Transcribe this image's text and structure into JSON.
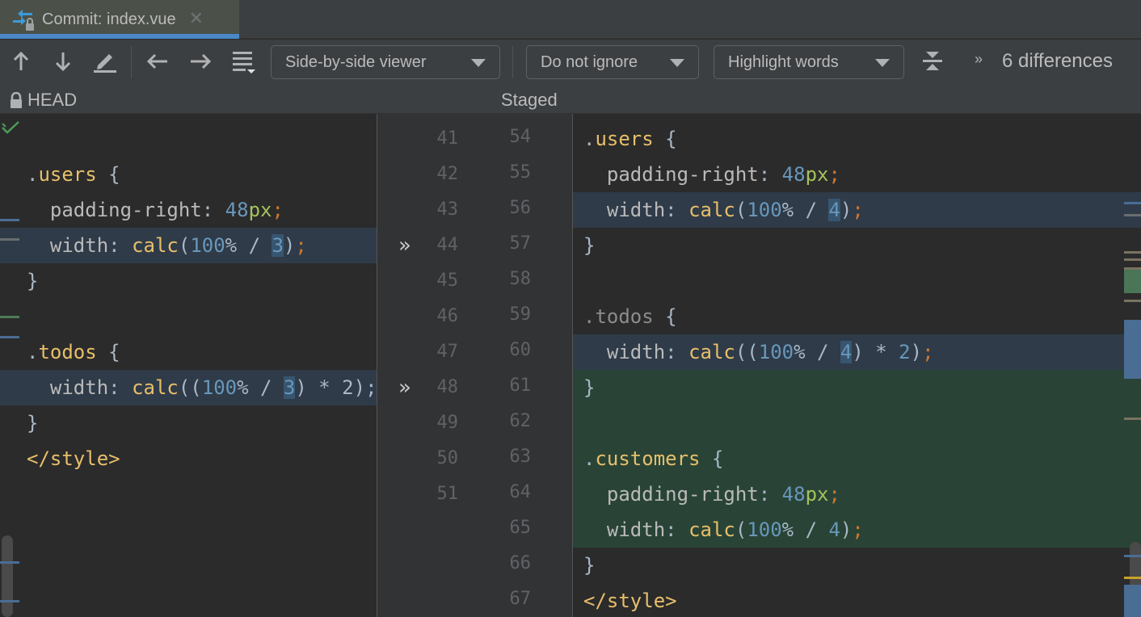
{
  "tab": {
    "title": "Commit: index.vue",
    "icon": "diff-commit-icon",
    "close_icon": "close-icon"
  },
  "toolbar": {
    "prev_diff_icon": "arrow-up-icon",
    "next_diff_icon": "arrow-down-icon",
    "edit_icon": "pencil-icon",
    "prev_file_icon": "arrow-left-icon",
    "next_file_icon": "arrow-right-icon",
    "jump_list_icon": "list-dropdown-icon",
    "viewer_mode": "Side-by-side viewer",
    "whitespace_mode": "Do not ignore",
    "highlight_mode": "Highlight words",
    "collapse_icon": "collapse-unchanged-icon",
    "more_icon": "double-chevron-right-icon",
    "more_glyph": "»",
    "differences": "6 differences"
  },
  "headers": {
    "left": "HEAD",
    "left_icon": "lock-icon",
    "right": "Staged"
  },
  "colors": {
    "accent": "#4a88c7",
    "modified_bg": "#2f3b48",
    "added_bg": "#294436",
    "word_highlight": "#385570",
    "connector": "#355572"
  },
  "left_pane": {
    "lines": [
      {
        "segments": []
      },
      {
        "segments": [
          {
            "t": ".",
            "c": "c-dot"
          },
          {
            "t": "users",
            "c": "c-sel"
          },
          {
            "t": " {",
            "c": "c-punc"
          }
        ]
      },
      {
        "segments": [
          {
            "t": "  padding-right",
            "c": "c-prop"
          },
          {
            "t": ": ",
            "c": "c-punc"
          },
          {
            "t": "48",
            "c": "c-num"
          },
          {
            "t": "px",
            "c": "c-unit"
          },
          {
            "t": ";",
            "c": "c-semi"
          }
        ]
      },
      {
        "hl": "hl-mod",
        "segments": [
          {
            "t": "  width",
            "c": "c-prop"
          },
          {
            "t": ": ",
            "c": "c-punc"
          },
          {
            "t": "calc",
            "c": "c-fn"
          },
          {
            "t": "(",
            "c": "c-punc"
          },
          {
            "t": "100",
            "c": "c-num"
          },
          {
            "t": "% / ",
            "c": "c-punc"
          },
          {
            "t": "3",
            "c": "c-num w-mod"
          },
          {
            "t": ")",
            "c": "c-punc"
          },
          {
            "t": ";",
            "c": "c-semi"
          }
        ]
      },
      {
        "segments": [
          {
            "t": "}",
            "c": "c-punc"
          }
        ]
      },
      {
        "segments": []
      },
      {
        "segments": [
          {
            "t": ".",
            "c": "c-dot"
          },
          {
            "t": "todos",
            "c": "c-sel"
          },
          {
            "t": " {",
            "c": "c-punc"
          }
        ]
      },
      {
        "hl": "hl-mod",
        "segments": [
          {
            "t": "  width",
            "c": "c-prop"
          },
          {
            "t": ": ",
            "c": "c-punc"
          },
          {
            "t": "calc",
            "c": "c-fn"
          },
          {
            "t": "((",
            "c": "c-punc"
          },
          {
            "t": "100",
            "c": "c-num"
          },
          {
            "t": "% / ",
            "c": "c-punc"
          },
          {
            "t": "3",
            "c": "c-num w-mod"
          },
          {
            "t": ") * 2);",
            "c": "c-punc"
          }
        ]
      },
      {
        "segments": [
          {
            "t": "}",
            "c": "c-punc"
          }
        ]
      },
      {
        "segments": [
          {
            "t": "</style>",
            "c": "c-tag"
          }
        ]
      }
    ],
    "line_numbers": [
      "41",
      "42",
      "43",
      "44",
      "45",
      "46",
      "47",
      "48",
      "49",
      "50",
      "51"
    ]
  },
  "right_pane": {
    "lines": [
      {
        "segments": [
          {
            "t": ".",
            "c": "c-dot"
          },
          {
            "t": "users",
            "c": "c-sel"
          },
          {
            "t": " {",
            "c": "c-punc"
          }
        ]
      },
      {
        "segments": [
          {
            "t": "  padding-right",
            "c": "c-prop"
          },
          {
            "t": ": ",
            "c": "c-punc"
          },
          {
            "t": "48",
            "c": "c-num"
          },
          {
            "t": "px",
            "c": "c-unit"
          },
          {
            "t": ";",
            "c": "c-semi"
          }
        ]
      },
      {
        "hl": "hl-mod",
        "segments": [
          {
            "t": "  width",
            "c": "c-prop"
          },
          {
            "t": ": ",
            "c": "c-punc"
          },
          {
            "t": "calc",
            "c": "c-fn"
          },
          {
            "t": "(",
            "c": "c-punc"
          },
          {
            "t": "100",
            "c": "c-num"
          },
          {
            "t": "% / ",
            "c": "c-punc"
          },
          {
            "t": "4",
            "c": "c-num w-mod"
          },
          {
            "t": ")",
            "c": "c-punc"
          },
          {
            "t": ";",
            "c": "c-semi"
          }
        ]
      },
      {
        "segments": [
          {
            "t": "}",
            "c": "c-punc"
          }
        ]
      },
      {
        "segments": []
      },
      {
        "segments": [
          {
            "t": ".todos",
            "c": "c-sel-dim"
          },
          {
            "t": " {",
            "c": "c-punc"
          }
        ]
      },
      {
        "hl": "hl-mod",
        "segments": [
          {
            "t": "  width",
            "c": "c-prop"
          },
          {
            "t": ": ",
            "c": "c-punc"
          },
          {
            "t": "calc",
            "c": "c-fn"
          },
          {
            "t": "((",
            "c": "c-punc"
          },
          {
            "t": "100",
            "c": "c-num"
          },
          {
            "t": "% / ",
            "c": "c-punc"
          },
          {
            "t": "4",
            "c": "c-num w-mod"
          },
          {
            "t": ") * ",
            "c": "c-punc"
          },
          {
            "t": "2",
            "c": "c-num"
          },
          {
            "t": ")",
            "c": "c-punc"
          },
          {
            "t": ";",
            "c": "c-semi"
          }
        ]
      },
      {
        "hl": "hl-add",
        "segments": [
          {
            "t": "}",
            "c": "c-punc"
          }
        ]
      },
      {
        "hl": "hl-add",
        "segments": []
      },
      {
        "hl": "hl-add",
        "segments": [
          {
            "t": ".",
            "c": "c-dot"
          },
          {
            "t": "customers",
            "c": "c-sel"
          },
          {
            "t": " {",
            "c": "c-punc"
          }
        ]
      },
      {
        "hl": "hl-add",
        "segments": [
          {
            "t": "  padding-right",
            "c": "c-prop"
          },
          {
            "t": ": ",
            "c": "c-punc"
          },
          {
            "t": "48",
            "c": "c-num"
          },
          {
            "t": "px",
            "c": "c-unit"
          },
          {
            "t": ";",
            "c": "c-semi"
          }
        ]
      },
      {
        "hl": "hl-add",
        "segments": [
          {
            "t": "  width",
            "c": "c-prop"
          },
          {
            "t": ": ",
            "c": "c-punc"
          },
          {
            "t": "calc",
            "c": "c-fn"
          },
          {
            "t": "(",
            "c": "c-punc"
          },
          {
            "t": "100",
            "c": "c-num"
          },
          {
            "t": "% / ",
            "c": "c-punc"
          },
          {
            "t": "4",
            "c": "c-num"
          },
          {
            "t": ")",
            "c": "c-punc"
          },
          {
            "t": ";",
            "c": "c-semi"
          }
        ]
      },
      {
        "segments": [
          {
            "t": "}",
            "c": "c-punc"
          }
        ]
      },
      {
        "segments": [
          {
            "t": "</style>",
            "c": "c-tag"
          }
        ]
      }
    ],
    "line_numbers": [
      "54",
      "55",
      "56",
      "57",
      "58",
      "59",
      "60",
      "61",
      "62",
      "63",
      "64",
      "65",
      "66",
      "67"
    ]
  },
  "gutter": {
    "apply_glyph": "»",
    "apply_icon": "apply-change-icon"
  },
  "status": {
    "inspection_icon": "inspection-ok-icon"
  }
}
